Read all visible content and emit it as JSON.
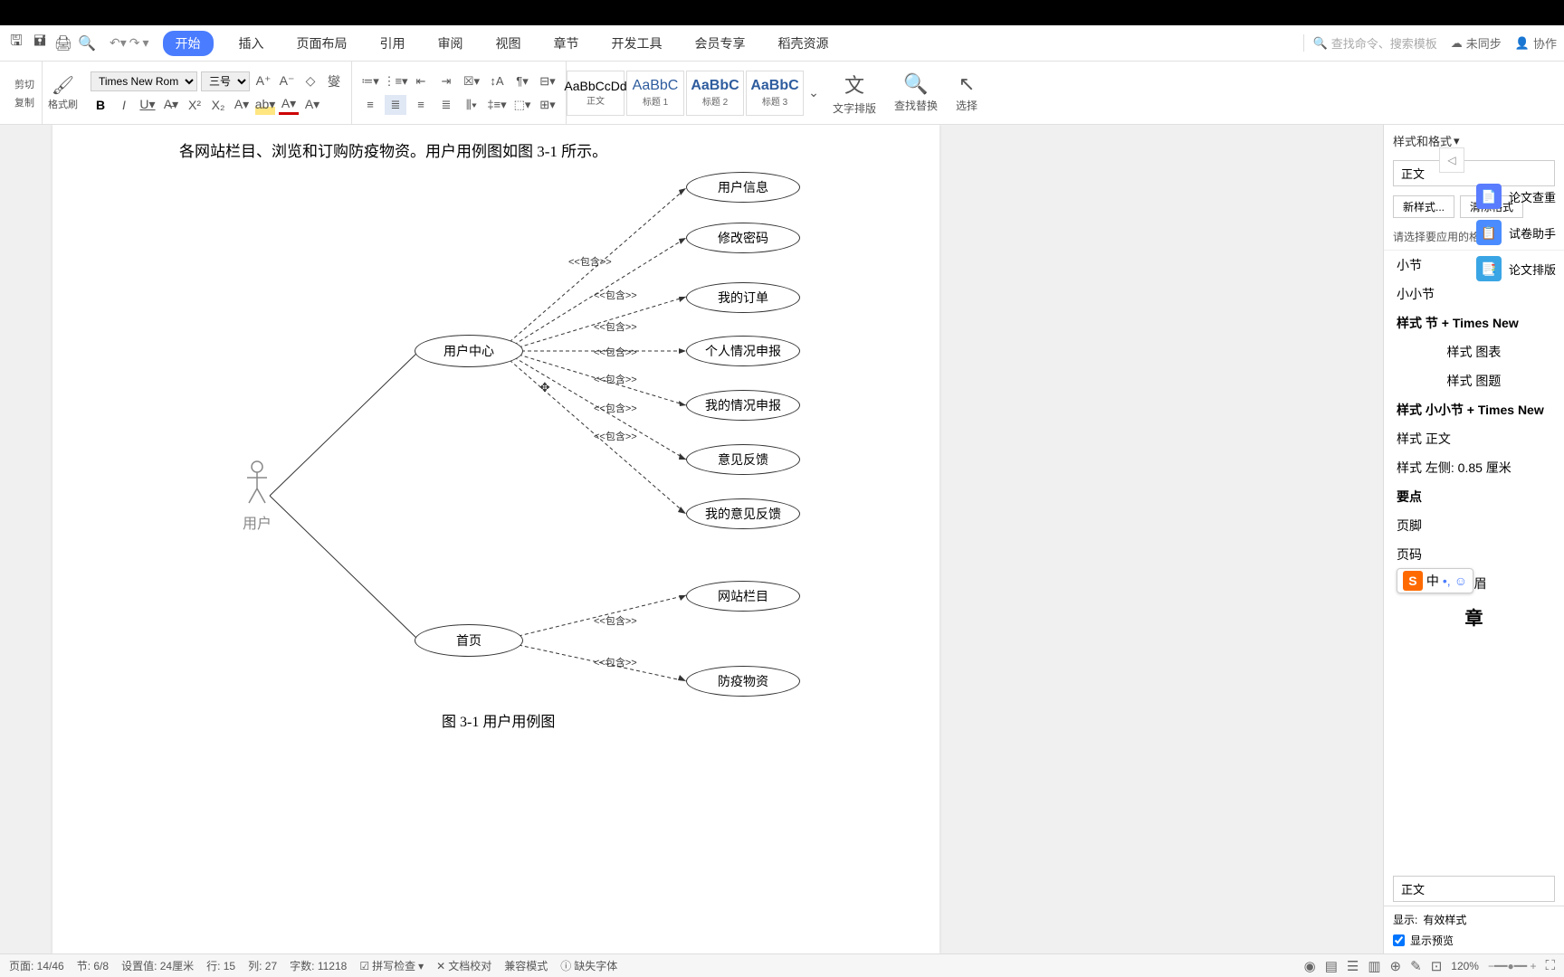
{
  "titlebar": {
    "menu": [
      "开始",
      "插入",
      "页面布局",
      "引用",
      "审阅",
      "视图",
      "章节",
      "开发工具",
      "会员专享",
      "稻壳资源"
    ],
    "search_placeholder": "查找命令、搜索模板",
    "sync": "未同步",
    "collab": "协作"
  },
  "ribbon": {
    "cut": "剪切",
    "copy": "复制",
    "brush": "格式刷",
    "font_name": "Times New Roma",
    "font_size": "三号",
    "styles": [
      {
        "sample": "AaBbCcDd",
        "name": "正文"
      },
      {
        "sample": "AaBbC",
        "name": "标题 1"
      },
      {
        "sample": "AaBbC",
        "name": "标题 2"
      },
      {
        "sample": "AaBbC",
        "name": "标题 3"
      }
    ],
    "text_layout": "文字排版",
    "find_replace": "查找替换",
    "select": "选择"
  },
  "document": {
    "para_text": "各网站栏目、浏览和订购防疫物资。用户用例图如图 3-1 所示。",
    "actor": "用户",
    "usecases": {
      "center": "用户中心",
      "home": "首页",
      "uc1": "用户信息",
      "uc2": "修改密码",
      "uc3": "我的订单",
      "uc4": "个人情况申报",
      "uc5": "我的情况申报",
      "uc6": "意见反馈",
      "uc7": "我的意见反馈",
      "uc8": "网站栏目",
      "uc9": "防疫物资"
    },
    "include": "<<包含>>",
    "caption": "图 3-1  用户用例图"
  },
  "side_tools": {
    "item1": "论文查重",
    "item2": "试卷助手",
    "item3": "论文排版"
  },
  "styles_panel": {
    "title": "样式和格式",
    "current": "正文",
    "new_style": "新样式...",
    "clear": "清除格式",
    "hint": "请选择要应用的格式",
    "items": [
      {
        "text": "小节",
        "cls": ""
      },
      {
        "text": "小小节",
        "cls": ""
      },
      {
        "text": "样式 节  + Times New",
        "cls": "bold"
      },
      {
        "text": "样式 图表",
        "cls": "center"
      },
      {
        "text": "样式 图题",
        "cls": "center"
      },
      {
        "text": "样式 小小节  + Times New",
        "cls": "bold"
      },
      {
        "text": "样式 正文",
        "cls": ""
      },
      {
        "text": "样式 左侧:  0.85 厘米",
        "cls": ""
      },
      {
        "text": "要点",
        "cls": "bold"
      },
      {
        "text": "页脚",
        "cls": ""
      },
      {
        "text": "页码",
        "cls": ""
      },
      {
        "text": "页眉",
        "cls": "center"
      },
      {
        "text": "章",
        "cls": "bold center"
      }
    ],
    "preview_text": "正文",
    "show_label": "显示:",
    "show_value": "有效样式",
    "show_preview": "显示预览"
  },
  "ime": {
    "lang": "中",
    "punct": "•,",
    "emoji": "☺"
  },
  "statusbar": {
    "page": "页面: 14/46",
    "section": "节: 6/8",
    "pos": "设置值: 24厘米",
    "line": "行: 15",
    "col": "列: 27",
    "words": "字数: 11218",
    "spell": "拼写检查",
    "doc_check": "文档校对",
    "compat": "兼容模式",
    "missing_font": "缺失字体",
    "zoom": "120%"
  }
}
